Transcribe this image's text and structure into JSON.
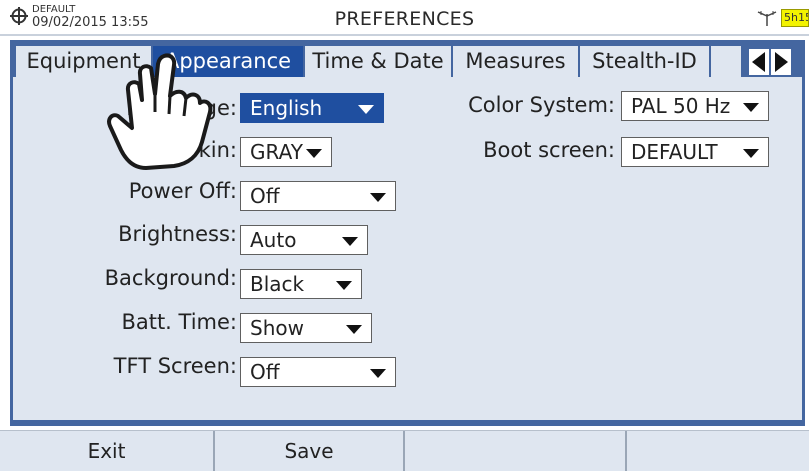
{
  "status_bar": {
    "profile": "DEFAULT",
    "datetime": "09/02/2015 13:55",
    "title": "PREFERENCES",
    "battery": "5h15",
    "icons": [
      "device-icon",
      "antenna-icon"
    ]
  },
  "tabs": [
    {
      "label": "Equipment"
    },
    {
      "label": "Appearance"
    },
    {
      "label": "Time & Date"
    },
    {
      "label": "Measures"
    },
    {
      "label": "Stealth-ID"
    }
  ],
  "active_tab": "Appearance",
  "settings": {
    "language": {
      "label": "Language:",
      "value": "English"
    },
    "skin": {
      "label": "Skin:",
      "value": "GRAY"
    },
    "power_off": {
      "label": "Power Off:",
      "value": "Off"
    },
    "brightness": {
      "label": "Brightness:",
      "value": "Auto"
    },
    "background": {
      "label": "Background:",
      "value": "Black"
    },
    "batt_time": {
      "label": "Batt. Time:",
      "value": "Show"
    },
    "tft_screen": {
      "label": "TFT Screen:",
      "value": "Off"
    },
    "color_system": {
      "label": "Color System:",
      "value": "PAL 50 Hz"
    },
    "boot_screen": {
      "label": "Boot screen:",
      "value": "DEFAULT"
    }
  },
  "softkeys": [
    "Exit",
    "Save",
    "",
    ""
  ],
  "colors": {
    "frame": "#4466a0",
    "active": "#1f4fa0",
    "panel": "#dfe6f0",
    "battery": "#f3f300"
  }
}
